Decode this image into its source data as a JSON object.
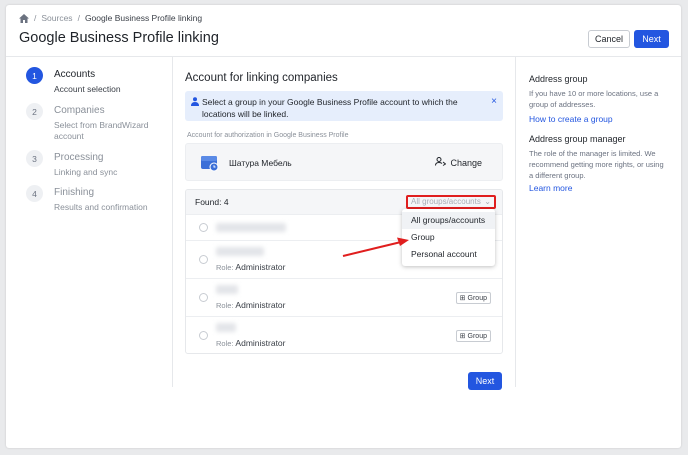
{
  "breadcrumb": {
    "home_icon": "home-icon",
    "items": [
      "Sources",
      "Google Business Profile linking"
    ]
  },
  "header": {
    "title": "Google Business Profile linking",
    "cancel_label": "Cancel",
    "next_label": "Next"
  },
  "steps": [
    {
      "num": "1",
      "title": "Accounts",
      "subtitle": "Account selection",
      "active": true
    },
    {
      "num": "2",
      "title": "Companies",
      "subtitle": "Select from BrandWizard account",
      "active": false
    },
    {
      "num": "3",
      "title": "Processing",
      "subtitle": "Linking and sync",
      "active": false
    },
    {
      "num": "4",
      "title": "Finishing",
      "subtitle": "Results and confirmation",
      "active": false
    }
  ],
  "main": {
    "title": "Account for linking companies",
    "alert_text": "Select a group in your Google Business Profile account to which the locations will be linked.",
    "alert_close": "×",
    "auth_label": "Account for authorization in Google Business Profile",
    "account_name": "Шатура Мебель",
    "change_label": "Change",
    "found_label": "Found: 4",
    "filter_value": "All groups/accounts",
    "rows": [
      {
        "role_key": "",
        "role_value": "",
        "tag": ""
      },
      {
        "role_key": "Role:",
        "role_value": "Administrator",
        "tag": ""
      },
      {
        "role_key": "Role:",
        "role_value": "Administrator",
        "tag": "Group"
      },
      {
        "role_key": "Role:",
        "role_value": "Administrator",
        "tag": "Group"
      }
    ],
    "next_label": "Next"
  },
  "dropdown": {
    "options": [
      "All groups/accounts",
      "Group",
      "Personal account"
    ],
    "selected": "All groups/accounts"
  },
  "sidebar": {
    "section1_title": "Address group",
    "section1_text": "If you have 10 or more locations, use a group of addresses.",
    "section1_link": "How to create a group",
    "section2_title": "Address group manager",
    "section2_text": "The role of the manager is limited. We recommend getting more rights, or using a different group.",
    "section2_link": "Learn more"
  },
  "colors": {
    "accent": "#2356e0",
    "highlight": "#e01e1e"
  }
}
